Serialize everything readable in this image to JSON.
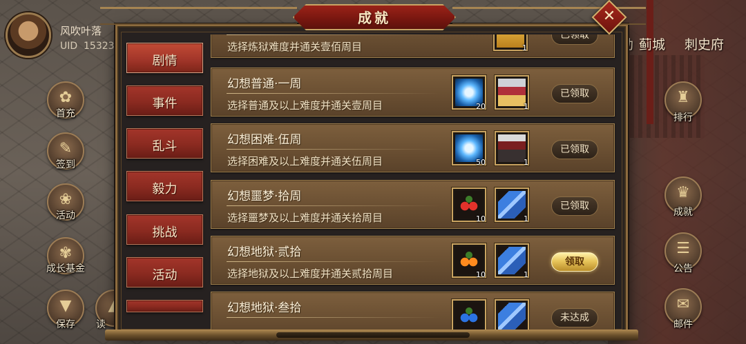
{
  "player": {
    "name": "风吹叶落",
    "uid_label": "UID",
    "uid_value": "15323"
  },
  "top_right_places": [
    "勃",
    "蓟城",
    "刺史府"
  ],
  "left_menu": [
    {
      "label": "首充",
      "icon": "gift-icon"
    },
    {
      "label": "签到",
      "icon": "checkin-icon"
    },
    {
      "label": "活动",
      "icon": "event-icon"
    },
    {
      "label": "成长基金",
      "icon": "fund-icon"
    },
    {
      "label": "保存",
      "icon": "save-icon"
    },
    {
      "label": "读",
      "icon": "load-icon"
    }
  ],
  "right_menu": [
    {
      "label": "排行",
      "icon": "ranking-icon"
    },
    {
      "label": "成就",
      "icon": "achievement-icon"
    },
    {
      "label": "公告",
      "icon": "announcement-icon"
    },
    {
      "label": "邮件",
      "icon": "mail-icon"
    }
  ],
  "dialog": {
    "title": "成就",
    "close_symbol": "✕"
  },
  "categories": [
    {
      "label": "剧情",
      "active": true
    },
    {
      "label": "事件",
      "active": false
    },
    {
      "label": "乱斗",
      "active": false
    },
    {
      "label": "毅力",
      "active": false
    },
    {
      "label": "挑战",
      "active": false
    },
    {
      "label": "活动",
      "active": false
    },
    {
      "label": "",
      "active": false
    }
  ],
  "achievements": [
    {
      "title": "",
      "desc": "选择炼狱难度并通关壹佰周目",
      "rewards": [
        {
          "icon": "gold-chest-icon",
          "count": "1"
        }
      ],
      "status": "已领取"
    },
    {
      "title": "幻想普通·一周",
      "desc": "选择普通及以上难度并通关壹周目",
      "rewards": [
        {
          "icon": "crystal-icon",
          "count": "20"
        },
        {
          "icon": "general-portrait-icon",
          "count": "1"
        }
      ],
      "status": "已领取"
    },
    {
      "title": "幻想困难·伍周",
      "desc": "选择困难及以上难度并通关伍周目",
      "rewards": [
        {
          "icon": "crystal-icon",
          "count": "50"
        },
        {
          "icon": "general-portrait-icon",
          "count": "1"
        }
      ],
      "status": "已领取"
    },
    {
      "title": "幻想噩梦·拾周",
      "desc": "选择噩梦及以上难度并通关拾周目",
      "rewards": [
        {
          "icon": "red-fruit-icon",
          "count": "10"
        },
        {
          "icon": "blue-scroll-icon",
          "count": "1"
        }
      ],
      "status": "已领取"
    },
    {
      "title": "幻想地狱·贰拾",
      "desc": "选择地狱及以上难度并通关贰拾周目",
      "rewards": [
        {
          "icon": "orange-fruit-icon",
          "count": "10"
        },
        {
          "icon": "blue-scroll-icon",
          "count": "1"
        }
      ],
      "status": "领取"
    },
    {
      "title": "幻想地狱·叁拾",
      "desc": "",
      "rewards": [
        {
          "icon": "blue-fruit-icon",
          "count": ""
        },
        {
          "icon": "blue-scroll-icon",
          "count": ""
        }
      ],
      "status": "未达成"
    }
  ]
}
